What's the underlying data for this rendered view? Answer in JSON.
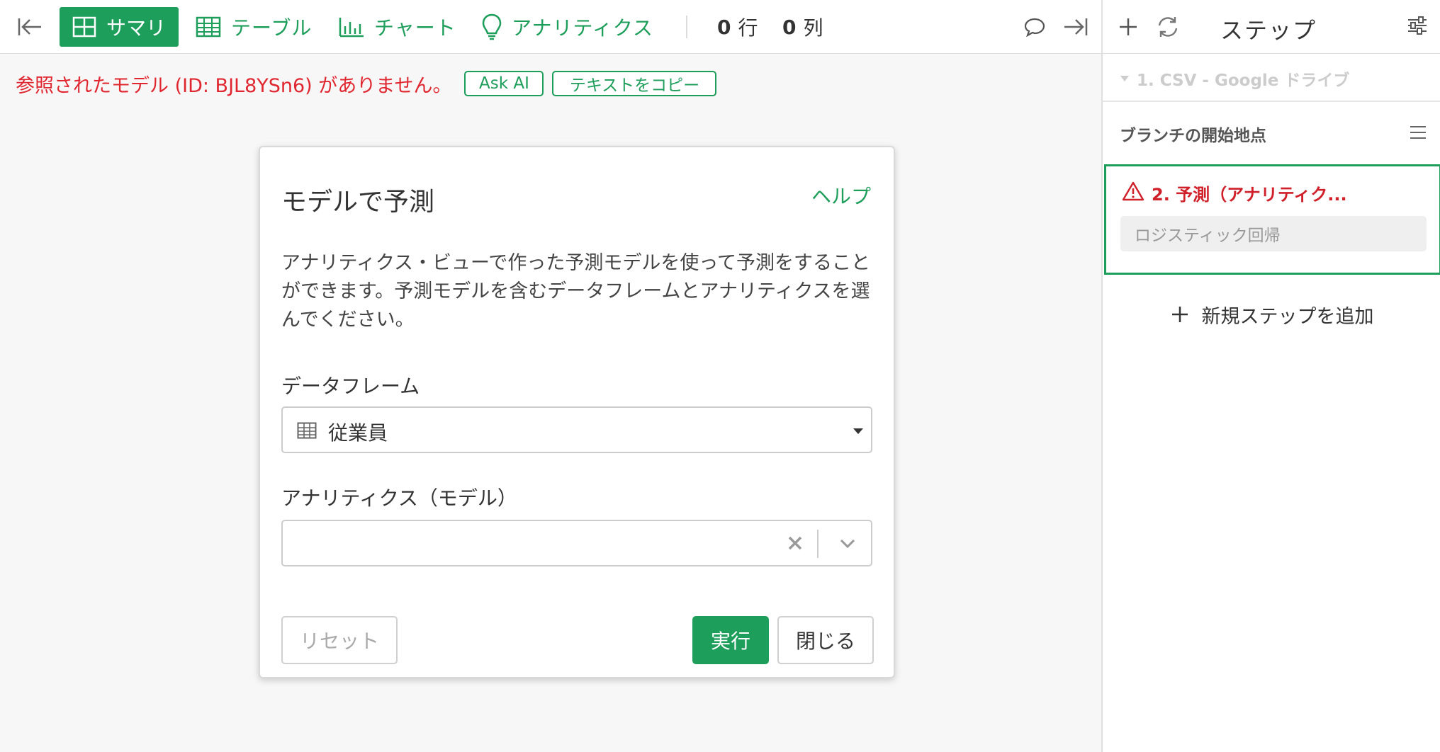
{
  "toolbar": {
    "tabs": {
      "summary": "サマリ",
      "table": "テーブル",
      "chart": "チャート",
      "analytics": "アナリティクス"
    },
    "rows": {
      "value": "0",
      "unit": "行"
    },
    "cols": {
      "value": "0",
      "unit": "列"
    }
  },
  "error": {
    "message": "参照されたモデル (ID: BJL8YSn6) がありません。",
    "ask_ai": "Ask AI",
    "copy_text": "テキストをコピー"
  },
  "dialog": {
    "title": "モデルで予測",
    "help": "ヘルプ",
    "description": "アナリティクス・ビューで作った予測モデルを使って予測をすることができます。予測モデルを含むデータフレームとアナリティクスを選んでください。",
    "dataframe_label": "データフレーム",
    "dataframe_value": "従業員",
    "analytics_label": "アナリティクス（モデル）",
    "analytics_value": "",
    "reset": "リセット",
    "run": "実行",
    "close": "閉じる"
  },
  "panel": {
    "title": "ステップ",
    "step1": "1. CSV - Google ドライブ",
    "branch": "ブランチの開始地点",
    "step2_title": "2. 予測（アナリティク...",
    "step2_sub": "ロジスティック回帰",
    "add_step": "新規ステップを追加"
  },
  "icons": {
    "collapse": "collapse-left-icon",
    "summary": "grid-icon",
    "table": "table-icon",
    "chart": "bar-chart-icon",
    "analytics": "lightbulb-icon",
    "comment": "comment-icon",
    "expand": "expand-right-icon",
    "add": "plus-icon",
    "refresh": "refresh-icon",
    "settings": "sliders-icon",
    "menu": "menu-icon",
    "warning": "warning-icon"
  },
  "colors": {
    "accent": "#1e9e5b",
    "error": "#e0262f",
    "step_error": "#d0202a"
  }
}
